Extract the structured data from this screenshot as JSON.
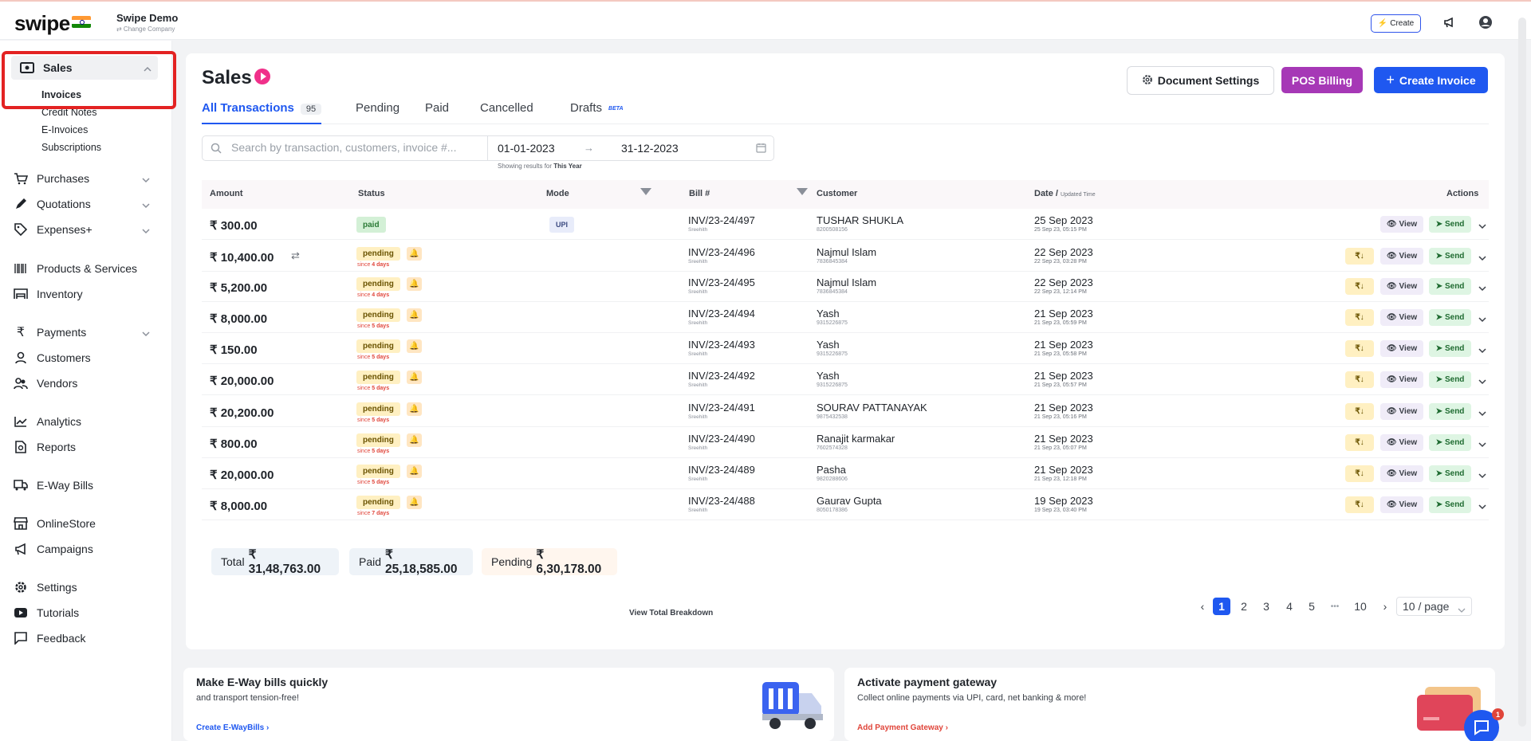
{
  "app": {
    "logo": "swipe",
    "company_name": "Swipe Demo",
    "change_company": "⇄ Change Company",
    "create_label": "Create"
  },
  "sidebar": {
    "sales": "Sales",
    "sub_items": [
      "Invoices",
      "Credit Notes",
      "E-Invoices",
      "Subscriptions"
    ],
    "items": [
      {
        "label": "Purchases",
        "icon": "cart-icon"
      },
      {
        "label": "Quotations",
        "icon": "pen-icon"
      },
      {
        "label": "Expenses+",
        "icon": "tag-icon"
      },
      {
        "label": "Products & Services",
        "icon": "barcode-icon"
      },
      {
        "label": "Inventory",
        "icon": "warehouse-icon"
      },
      {
        "label": "Payments",
        "icon": "rupee-icon"
      },
      {
        "label": "Customers",
        "icon": "user-icon"
      },
      {
        "label": "Vendors",
        "icon": "users-icon"
      },
      {
        "label": "Analytics",
        "icon": "chart-icon"
      },
      {
        "label": "Reports",
        "icon": "report-icon"
      },
      {
        "label": "E-Way Bills",
        "icon": "truck-icon"
      },
      {
        "label": "OnlineStore",
        "icon": "store-icon"
      },
      {
        "label": "Campaigns",
        "icon": "megaphone-icon"
      },
      {
        "label": "Settings",
        "icon": "gear-icon"
      },
      {
        "label": "Tutorials",
        "icon": "youtube-icon"
      },
      {
        "label": "Feedback",
        "icon": "comment-icon"
      }
    ]
  },
  "main": {
    "title": "Sales",
    "buttons": {
      "document_settings": "Document Settings",
      "pos_billing": "POS Billing",
      "create_invoice": "Create Invoice"
    },
    "tabs": [
      {
        "label": "All Transactions",
        "badge": "95"
      },
      {
        "label": "Pending"
      },
      {
        "label": "Paid"
      },
      {
        "label": "Cancelled"
      },
      {
        "label": "Drafts",
        "tag": "BETA"
      }
    ],
    "search": {
      "placeholder": "Search by transaction, customers, invoice #...",
      "date_from": "01-01-2023",
      "date_to": "31-12-2023",
      "showing_prefix": "Showing results for",
      "showing_range": "This Year"
    },
    "columns": {
      "amount": "Amount",
      "status": "Status",
      "mode": "Mode",
      "bill": "Bill #",
      "customer": "Customer",
      "date": "Date /",
      "date_sub": "Updated Time",
      "actions": "Actions"
    },
    "action_labels": {
      "pay": "₹↓",
      "view": "View",
      "send": "Send"
    },
    "rows": [
      {
        "amount": "₹ 300.00",
        "status": "paid",
        "since": "",
        "mode": "UPI",
        "bill": "INV/23-24/497",
        "bill_by": "Sreehith",
        "customer": "TUSHAR SHUKLA",
        "phone": "8200508156",
        "date": "25 Sep 2023",
        "time": "25 Sep 23, 05:15 PM"
      },
      {
        "amount": "₹ 10,400.00",
        "status": "pending",
        "since": "4 days",
        "mode": "",
        "bill": "INV/23-24/496",
        "bill_by": "Sreehith",
        "customer": "Najmul Islam",
        "phone": "7836845384",
        "date": "22 Sep 2023",
        "time": "22 Sep 23, 03:28 PM"
      },
      {
        "amount": "₹ 5,200.00",
        "status": "pending",
        "since": "4 days",
        "mode": "",
        "bill": "INV/23-24/495",
        "bill_by": "Sreehith",
        "customer": "Najmul Islam",
        "phone": "7836845384",
        "date": "22 Sep 2023",
        "time": "22 Sep 23, 12:14 PM"
      },
      {
        "amount": "₹ 8,000.00",
        "status": "pending",
        "since": "5 days",
        "mode": "",
        "bill": "INV/23-24/494",
        "bill_by": "Sreehith",
        "customer": "Yash",
        "phone": "9315226875",
        "date": "21 Sep 2023",
        "time": "21 Sep 23, 05:59 PM"
      },
      {
        "amount": "₹ 150.00",
        "status": "pending",
        "since": "5 days",
        "mode": "",
        "bill": "INV/23-24/493",
        "bill_by": "Sreehith",
        "customer": "Yash",
        "phone": "9315226875",
        "date": "21 Sep 2023",
        "time": "21 Sep 23, 05:58 PM"
      },
      {
        "amount": "₹ 20,000.00",
        "status": "pending",
        "since": "5 days",
        "mode": "",
        "bill": "INV/23-24/492",
        "bill_by": "Sreehith",
        "customer": "Yash",
        "phone": "9315226875",
        "date": "21 Sep 2023",
        "time": "21 Sep 23, 05:57 PM"
      },
      {
        "amount": "₹ 20,200.00",
        "status": "pending",
        "since": "5 days",
        "mode": "",
        "bill": "INV/23-24/491",
        "bill_by": "Sreehith",
        "customer": "SOURAV PATTANAYAK",
        "phone": "9875432538",
        "date": "21 Sep 2023",
        "time": "21 Sep 23, 05:16 PM"
      },
      {
        "amount": "₹ 800.00",
        "status": "pending",
        "since": "5 days",
        "mode": "",
        "bill": "INV/23-24/490",
        "bill_by": "Sreehith",
        "customer": "Ranajit karmakar",
        "phone": "7602574328",
        "date": "21 Sep 2023",
        "time": "21 Sep 23, 05:07 PM"
      },
      {
        "amount": "₹ 20,000.00",
        "status": "pending",
        "since": "5 days",
        "mode": "",
        "bill": "INV/23-24/489",
        "bill_by": "Sreehith",
        "customer": "Pasha",
        "phone": "9820288606",
        "date": "21 Sep 2023",
        "time": "21 Sep 23, 12:18 PM"
      },
      {
        "amount": "₹ 8,000.00",
        "status": "pending",
        "since": "7 days",
        "mode": "",
        "bill": "INV/23-24/488",
        "bill_by": "Sreehith",
        "customer": "Gaurav Gupta",
        "phone": "8050178386",
        "date": "19 Sep 2023",
        "time": "19 Sep 23, 03:40 PM"
      }
    ],
    "totals": {
      "total_label": "Total",
      "total_value": "₹ 31,48,763.00",
      "paid_label": "Paid",
      "paid_value": "₹ 25,18,585.00",
      "pending_label": "Pending",
      "pending_value": "₹ 6,30,178.00",
      "breakdown": "View Total Breakdown"
    },
    "pagination": {
      "pages": [
        "1",
        "2",
        "3",
        "4",
        "5"
      ],
      "ellipsis": "•••",
      "last": "10",
      "page_size": "10 / page",
      "current": 1
    }
  },
  "promos": [
    {
      "title": "Make E-Way bills quickly",
      "subtitle": "and transport tension-free!",
      "link": "Create E-WayBills"
    },
    {
      "title": "Activate payment gateway",
      "subtitle": "Collect online payments via UPI, card, net banking & more!",
      "link": "Add Payment Gateway"
    }
  ],
  "chat": {
    "badge": "1"
  },
  "colors": {
    "primary": "#1f58f0",
    "pos": "#a638b6",
    "highlight": "#e32222",
    "pending": "#fff0c2",
    "paid": "#d3f0d6"
  }
}
